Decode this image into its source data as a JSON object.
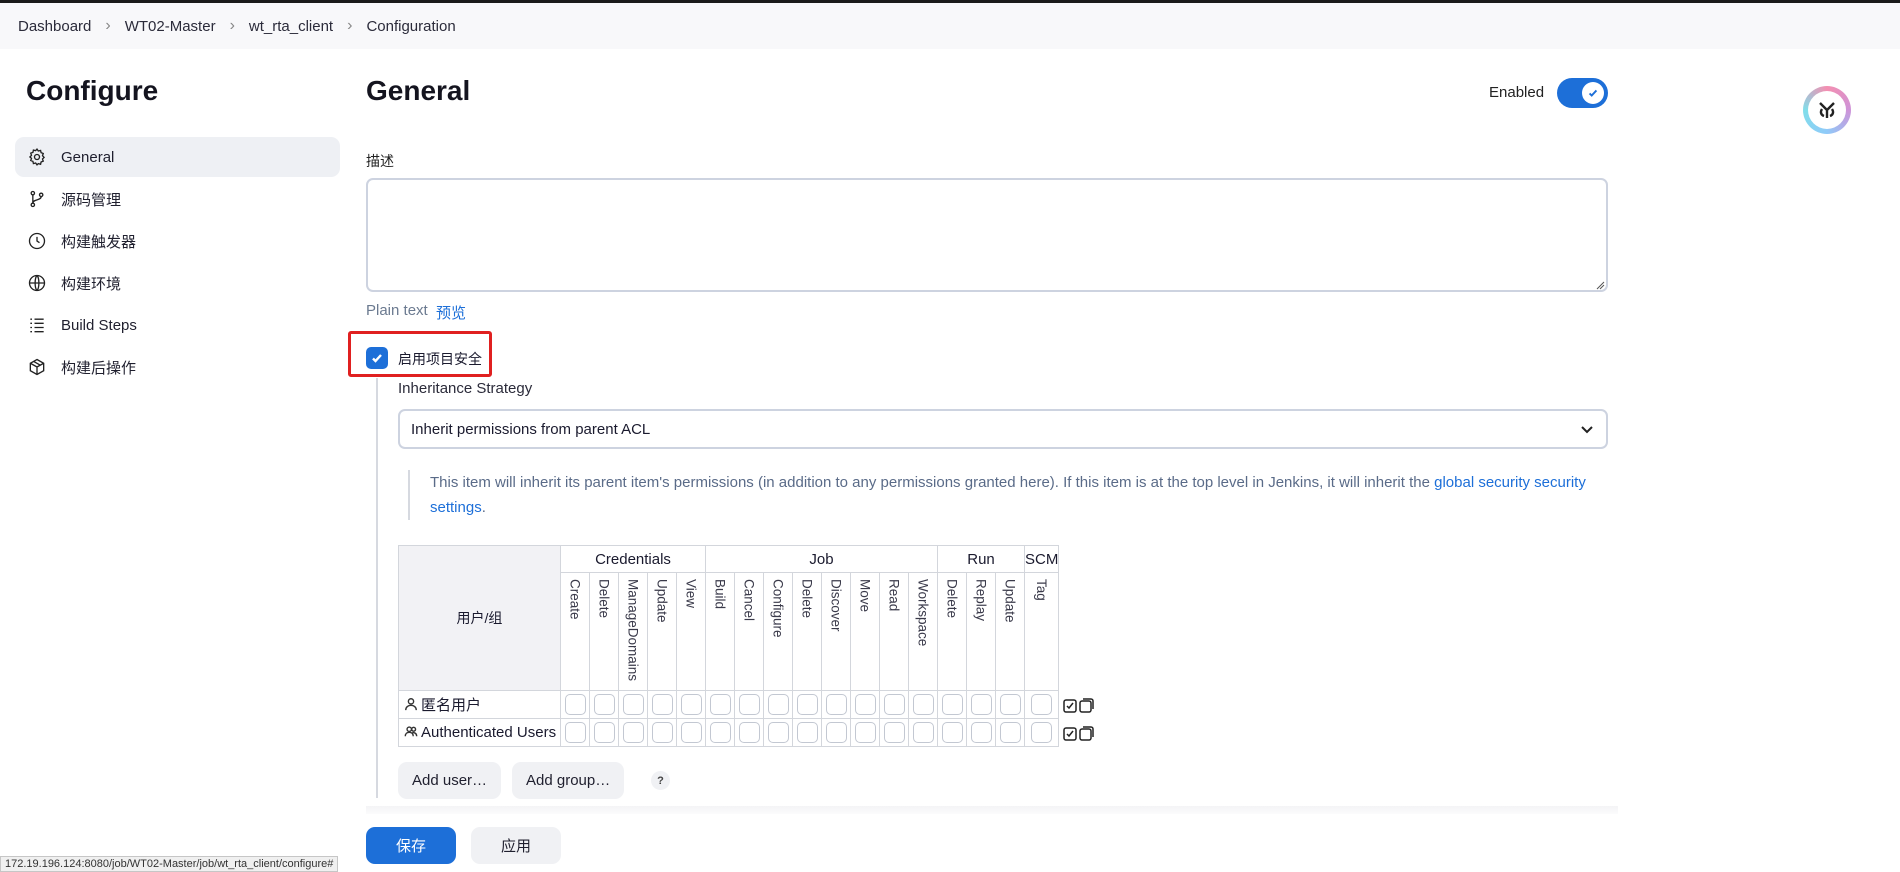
{
  "breadcrumb": [
    "Dashboard",
    "WT02-Master",
    "wt_rta_client",
    "Configuration"
  ],
  "sidebar": {
    "title": "Configure",
    "items": [
      {
        "label": "General",
        "icon": "gear-icon",
        "active": true
      },
      {
        "label": "源码管理",
        "icon": "branch-icon",
        "active": false
      },
      {
        "label": "构建触发器",
        "icon": "timer-icon",
        "active": false
      },
      {
        "label": "构建环境",
        "icon": "globe-icon",
        "active": false
      },
      {
        "label": "Build Steps",
        "icon": "list-icon",
        "active": false
      },
      {
        "label": "构建后操作",
        "icon": "package-icon",
        "active": false
      }
    ]
  },
  "main": {
    "title": "General",
    "enabled_label": "Enabled",
    "enabled": true,
    "description_label": "描述",
    "description_value": "",
    "plain_text": "Plain text",
    "preview_link": "预览",
    "security_checkbox_label": "启用项目安全",
    "security_checked": true,
    "inheritance_label": "Inheritance Strategy",
    "inheritance_value": "Inherit permissions from parent ACL",
    "info_text": "This item will inherit its parent item's permissions (in addition to any permissions granted here). If this item is at the top level in Jenkins, it will inherit the ",
    "info_link": "global security security settings",
    "info_end": "."
  },
  "permissions": {
    "user_col": "用户/组",
    "groups": [
      {
        "name": "Credentials",
        "span": 5
      },
      {
        "name": "Job",
        "span": 8
      },
      {
        "name": "Run",
        "span": 3
      },
      {
        "name": "SCM",
        "span": 1
      }
    ],
    "columns": [
      "Create",
      "Delete",
      "ManageDomains",
      "Update",
      "View",
      "Build",
      "Cancel",
      "Configure",
      "Delete",
      "Discover",
      "Move",
      "Read",
      "Workspace",
      "Delete",
      "Replay",
      "Update",
      "Tag"
    ],
    "rows": [
      {
        "name": "匿名用户",
        "icon": "user-icon"
      },
      {
        "name": "Authenticated Users",
        "icon": "users-icon"
      }
    ],
    "add_user": "Add user…",
    "add_group": "Add group…",
    "help": "?"
  },
  "footer": {
    "save": "保存",
    "apply": "应用"
  },
  "status_url": "172.19.196.124:8080/job/WT02-Master/job/wt_rta_client/configure#",
  "colors": {
    "accent": "#1d6fd8",
    "highlight_border": "#e02020"
  }
}
